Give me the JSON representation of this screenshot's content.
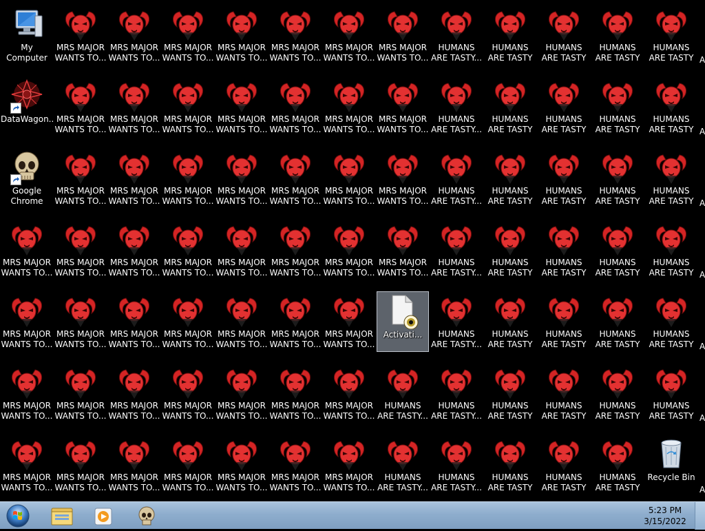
{
  "desktop": {
    "left_column": [
      {
        "label": "My Computer",
        "icon": "computer-icon",
        "shortcut": false
      },
      {
        "label": "DataWagon...",
        "icon": "datawagon-icon",
        "shortcut": true
      },
      {
        "label": "Google\nChrome",
        "icon": "skull-icon",
        "shortcut": true
      },
      {
        "label": "MRS MAJOR\nWANTS TO...",
        "icon": "demon-icon",
        "shortcut": false
      },
      {
        "label": "MRS MAJOR\nWANTS TO...",
        "icon": "demon-icon",
        "shortcut": false
      },
      {
        "label": "MRS MAJOR\nWANTS TO...",
        "icon": "demon-icon",
        "shortcut": false
      },
      {
        "label": "MRS MAJOR\nWANTS TO...",
        "icon": "demon-icon",
        "shortcut": false
      }
    ],
    "demon_rows": [
      [
        "MRS MAJOR\nWANTS TO...",
        "MRS MAJOR\nWANTS TO...",
        "MRS MAJOR\nWANTS TO...",
        "MRS MAJOR\nWANTS TO...",
        "MRS MAJOR\nWANTS TO...",
        "MRS MAJOR\nWANTS TO...",
        "MRS MAJOR\nWANTS TO...",
        "HUMANS\nARE TASTY...",
        "HUMANS\nARE TASTY ...",
        "HUMANS\nARE TASTY ...",
        "HUMANS\nARE TASTY ...",
        "HUMANS\nARE TASTY ..."
      ],
      [
        "MRS MAJOR\nWANTS TO...",
        "MRS MAJOR\nWANTS TO...",
        "MRS MAJOR\nWANTS TO...",
        "MRS MAJOR\nWANTS TO...",
        "MRS MAJOR\nWANTS TO...",
        "MRS MAJOR\nWANTS TO...",
        "MRS MAJOR\nWANTS TO...",
        "HUMANS\nARE TASTY...",
        "HUMANS\nARE TASTY ...",
        "HUMANS\nARE TASTY ...",
        "HUMANS\nARE TASTY ...",
        "HUMANS\nARE TASTY ..."
      ],
      [
        "MRS MAJOR\nWANTS TO...",
        "MRS MAJOR\nWANTS TO...",
        "MRS MAJOR\nWANTS TO...",
        "MRS MAJOR\nWANTS TO...",
        "MRS MAJOR\nWANTS TO...",
        "MRS MAJOR\nWANTS TO...",
        "MRS MAJOR\nWANTS TO...",
        "HUMANS\nARE TASTY...",
        "HUMANS\nARE TASTY ...",
        "HUMANS\nARE TASTY ...",
        "HUMANS\nARE TASTY ...",
        "HUMANS\nARE TASTY ..."
      ],
      [
        "MRS MAJOR\nWANTS TO...",
        "MRS MAJOR\nWANTS TO...",
        "MRS MAJOR\nWANTS TO...",
        "MRS MAJOR\nWANTS TO...",
        "MRS MAJOR\nWANTS TO...",
        "MRS MAJOR\nWANTS TO...",
        "MRS MAJOR\nWANTS TO...",
        "HUMANS\nARE TASTY...",
        "HUMANS\nARE TASTY ...",
        "HUMANS\nARE TASTY ...",
        "HUMANS\nARE TASTY ...",
        "HUMANS\nARE TASTY ..."
      ],
      [
        "MRS MAJOR\nWANTS TO...",
        "MRS MAJOR\nWANTS TO...",
        "MRS MAJOR\nWANTS TO...",
        "MRS MAJOR\nWANTS TO...",
        "MRS MAJOR\nWANTS TO...",
        "MRS MAJOR\nWANTS TO...",
        "Activati...",
        "HUMANS\nARE TASTY...",
        "HUMANS\nARE TASTY ...",
        "HUMANS\nARE TASTY ...",
        "HUMANS\nARE TASTY ...",
        "HUMANS\nARE TASTY ..."
      ],
      [
        "MRS MAJOR\nWANTS TO...",
        "MRS MAJOR\nWANTS TO...",
        "MRS MAJOR\nWANTS TO...",
        "MRS MAJOR\nWANTS TO...",
        "MRS MAJOR\nWANTS TO...",
        "MRS MAJOR\nWANTS TO...",
        "HUMANS\nARE TASTY...",
        "HUMANS\nARE TASTY...",
        "HUMANS\nARE TASTY ...",
        "HUMANS\nARE TASTY ...",
        "HUMANS\nARE TASTY ...",
        "HUMANS\nARE TASTY ..."
      ],
      [
        "MRS MAJOR\nWANTS TO...",
        "MRS MAJOR\nWANTS TO...",
        "MRS MAJOR\nWANTS TO...",
        "MRS MAJOR\nWANTS TO...",
        "MRS MAJOR\nWANTS TO...",
        "MRS MAJOR\nWANTS TO...",
        "HUMANS\nARE TASTY...",
        "HUMANS\nARE TASTY...",
        "HUMANS\nARE TASTY ...",
        "HUMANS\nARE TASTY ...",
        "HUMANS\nARE TASTY ...",
        "Recycle Bin"
      ]
    ],
    "special_icons": {
      "activation": {
        "label": "Activati...",
        "icon": "file-eye-icon"
      },
      "recycle_bin": {
        "label": "Recycle Bin",
        "icon": "recycle-bin-icon"
      }
    },
    "edge_letters": [
      "A",
      "A",
      "A",
      "A",
      "A",
      "A",
      "A"
    ]
  },
  "taskbar": {
    "start": {
      "icon": "windows-orb-icon"
    },
    "pinned": [
      {
        "name": "explorer",
        "icon": "folder-icon"
      },
      {
        "name": "media-player",
        "icon": "media-player-icon"
      },
      {
        "name": "skull",
        "icon": "skull-icon"
      }
    ],
    "clock": {
      "time": "5:23 PM",
      "date": "3/15/2022"
    }
  },
  "colors": {
    "desktop_bg": "#000000",
    "demon_red": "#e02a2a",
    "taskbar": "#8eadcd"
  }
}
